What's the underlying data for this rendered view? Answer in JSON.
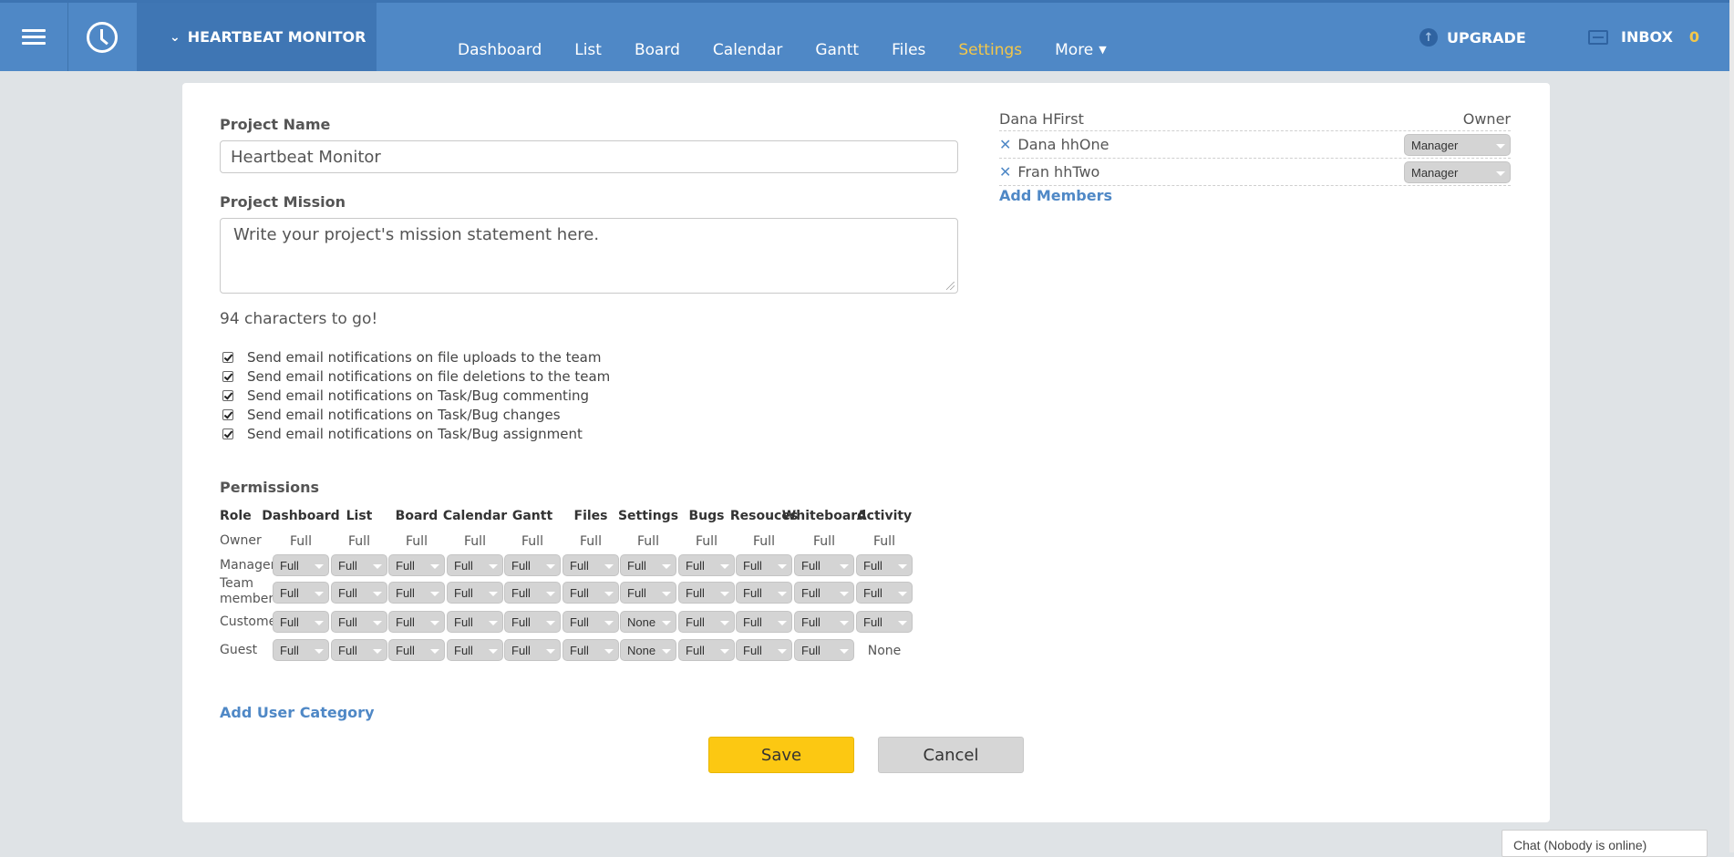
{
  "header": {
    "project_name": "HEARTBEAT MONITOR",
    "tabs": [
      {
        "label": "Dashboard"
      },
      {
        "label": "List"
      },
      {
        "label": "Board"
      },
      {
        "label": "Calendar"
      },
      {
        "label": "Gantt"
      },
      {
        "label": "Files"
      },
      {
        "label": "Settings",
        "active": true
      },
      {
        "label": "More"
      }
    ],
    "upgrade_label": "UPGRADE",
    "inbox_label": "INBOX",
    "inbox_count": "0"
  },
  "form": {
    "project_name_label": "Project Name",
    "project_name_value": "Heartbeat Monitor",
    "mission_label": "Project Mission",
    "mission_placeholder": "Write your project's mission statement here.",
    "chars_left": "94 characters to go!",
    "notifications": [
      {
        "label": "Send email notifications on file uploads to the team",
        "checked": true
      },
      {
        "label": "Send email notifications on file deletions to the team",
        "checked": true
      },
      {
        "label": "Send email notifications on Task/Bug commenting",
        "checked": true
      },
      {
        "label": "Send email notifications on Task/Bug changes",
        "checked": true
      },
      {
        "label": "Send email notifications on Task/Bug assignment",
        "checked": true
      }
    ]
  },
  "permissions": {
    "title": "Permissions",
    "columns": [
      "Role",
      "Dashboard",
      "List",
      "Board",
      "Calendar",
      "Gantt",
      "Files",
      "Settings",
      "Bugs",
      "Resouces",
      "Whiteboard",
      "Activity"
    ],
    "rows": [
      {
        "role": "Owner",
        "cells": [
          "Full",
          "Full",
          "Full",
          "Full",
          "Full",
          "Full",
          "Full",
          "Full",
          "Full",
          "Full",
          "Full"
        ],
        "select": [
          false,
          false,
          false,
          false,
          false,
          false,
          false,
          false,
          false,
          false,
          false
        ]
      },
      {
        "role": "Manager",
        "cells": [
          "Full",
          "Full",
          "Full",
          "Full",
          "Full",
          "Full",
          "Full",
          "Full",
          "Full",
          "Full",
          "Full"
        ],
        "select": [
          true,
          true,
          true,
          true,
          true,
          true,
          true,
          true,
          true,
          true,
          true
        ]
      },
      {
        "role": "Team member",
        "cells": [
          "Full",
          "Full",
          "Full",
          "Full",
          "Full",
          "Full",
          "Full",
          "Full",
          "Full",
          "Full",
          "Full"
        ],
        "select": [
          true,
          true,
          true,
          true,
          true,
          true,
          true,
          true,
          true,
          true,
          true
        ]
      },
      {
        "role": "Customer",
        "cells": [
          "Full",
          "Full",
          "Full",
          "Full",
          "Full",
          "Full",
          "None",
          "Full",
          "Full",
          "Full",
          "Full"
        ],
        "select": [
          true,
          true,
          true,
          true,
          true,
          true,
          true,
          true,
          true,
          true,
          true
        ]
      },
      {
        "role": "Guest",
        "cells": [
          "Full",
          "Full",
          "Full",
          "Full",
          "Full",
          "Full",
          "None",
          "Full",
          "Full",
          "Full",
          "None"
        ],
        "select": [
          true,
          true,
          true,
          true,
          true,
          true,
          true,
          true,
          true,
          true,
          false
        ]
      }
    ],
    "add_category_label": "Add User Category"
  },
  "actions": {
    "save_label": "Save",
    "cancel_label": "Cancel"
  },
  "members": {
    "owner": {
      "name": "Dana HFirst",
      "role": "Owner"
    },
    "list": [
      {
        "name": "Dana hhOne",
        "role": "Manager"
      },
      {
        "name": "Fran hhTwo",
        "role": "Manager"
      }
    ],
    "add_label": "Add Members"
  },
  "chat": {
    "label": "Chat (Nobody is online)"
  },
  "colors": {
    "header_bg": "#4f88c6",
    "accent_active": "#f3c74a",
    "link": "#4f88c6",
    "save_button": "#fcc812"
  }
}
